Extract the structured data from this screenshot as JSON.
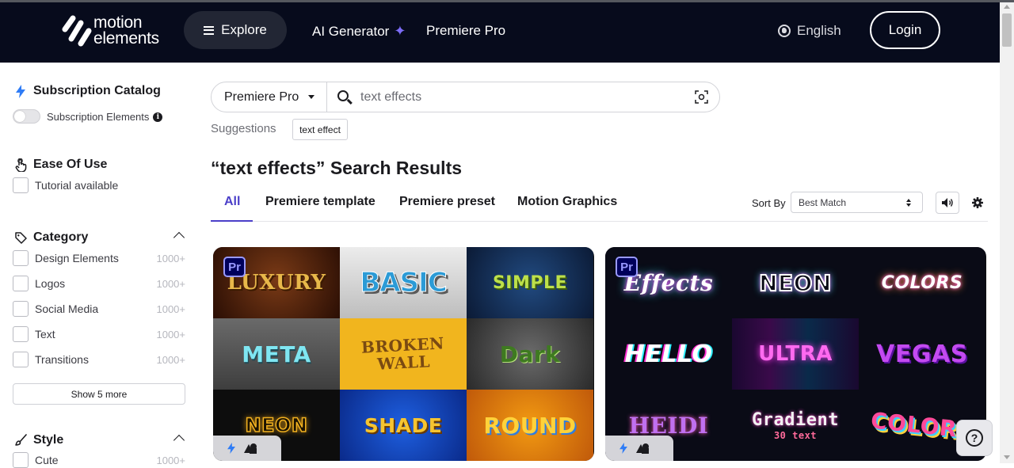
{
  "header": {
    "logo_line1": "motion",
    "logo_line2": "elements",
    "explore_label": "Explore",
    "ai_generator_label": "AI Generator",
    "premiere_pro_label": "Premiere Pro",
    "language_label": "English",
    "login_label": "Login",
    "bg_color": "#070b1c"
  },
  "sidebar": {
    "subscription": {
      "title": "Subscription Catalog",
      "toggle_label": "Subscription Elements",
      "info_glyph": "i"
    },
    "ease_of_use": {
      "title": "Ease Of Use",
      "items": [
        {
          "label": "Tutorial available"
        }
      ]
    },
    "category": {
      "title": "Category",
      "items": [
        {
          "label": "Design Elements",
          "count": "1000+"
        },
        {
          "label": "Logos",
          "count": "1000+"
        },
        {
          "label": "Social Media",
          "count": "1000+"
        },
        {
          "label": "Text",
          "count": "1000+"
        },
        {
          "label": "Transitions",
          "count": "1000+"
        }
      ],
      "show_more_label": "Show 5 more"
    },
    "style": {
      "title": "Style",
      "items": [
        {
          "label": "Cute",
          "count": "1000+"
        }
      ]
    }
  },
  "search": {
    "scope_value": "Premiere Pro",
    "query": "text effects",
    "suggestions_label": "Suggestions",
    "suggestions": [
      "text effect"
    ]
  },
  "results": {
    "title": "“text effects” Search Results",
    "tabs": [
      "All",
      "Premiere template",
      "Premiere preset",
      "Motion Graphics"
    ],
    "active_tab": "All",
    "sort_label": "Sort By",
    "sort_value": "Best Match",
    "accent_color": "#4b3fc9"
  },
  "cards": [
    {
      "badge": "Pr",
      "tiles": [
        "LUXURY",
        "BASIC",
        "SIMPLE",
        "META",
        "BROKEN WALL",
        "Dark",
        "NEON",
        "SHADE",
        "ROUND"
      ]
    },
    {
      "badge": "Pr",
      "tiles": [
        "Effects",
        "NEON",
        "COLORS",
        "HELLO",
        "ULTRA",
        "VEGAS",
        "HEIDI",
        "Gradient",
        "COLORS"
      ],
      "tile_subtitles": {
        "7": "30 text"
      }
    }
  ],
  "help": {
    "glyph": "?"
  }
}
